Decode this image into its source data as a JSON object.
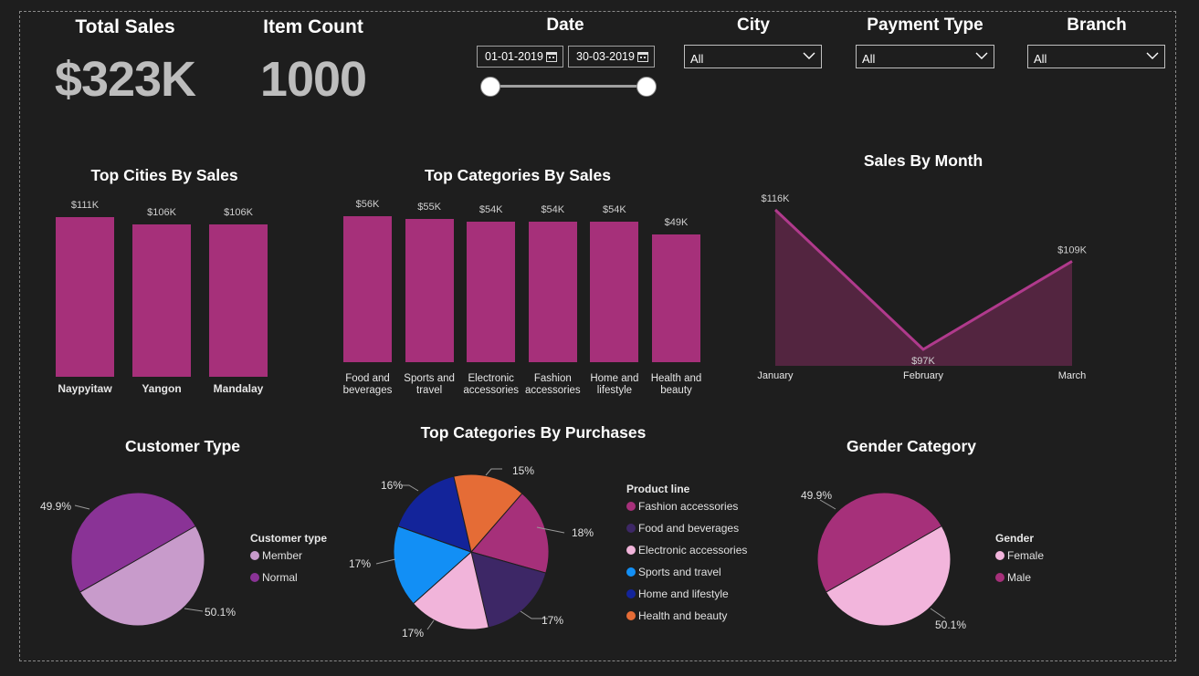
{
  "kpis": {
    "total_sales": {
      "title": "Total Sales",
      "value": "$323K"
    },
    "item_count": {
      "title": "Item Count",
      "value": "1000"
    }
  },
  "filters": {
    "date": {
      "title": "Date",
      "start": "01-01-2019",
      "end": "30-03-2019"
    },
    "city": {
      "title": "City",
      "value": "All"
    },
    "payment_type": {
      "title": "Payment Type",
      "value": "All"
    },
    "branch": {
      "title": "Branch",
      "value": "All"
    }
  },
  "colors": {
    "bar": "#a6307a",
    "line": "#b03a8c",
    "area": "#532540"
  },
  "charts": {
    "top_cities": {
      "title": "Top Cities By Sales",
      "chart_data": {
        "type": "bar",
        "categories": [
          "Naypyitaw",
          "Yangon",
          "Mandalay"
        ],
        "values": [
          111,
          106,
          106
        ],
        "labels": [
          "$111K",
          "$106K",
          "$106K"
        ],
        "unit": "K"
      }
    },
    "top_categories": {
      "title": "Top Categories By Sales",
      "chart_data": {
        "type": "bar",
        "categories": [
          [
            "Food and",
            "beverages"
          ],
          [
            "Sports and",
            "travel"
          ],
          [
            "Electronic",
            "accessories"
          ],
          [
            "Fashion",
            "accessories"
          ],
          [
            "Home and",
            "lifestyle"
          ],
          [
            "Health and",
            "beauty"
          ]
        ],
        "values": [
          56,
          55,
          54,
          54,
          54,
          49
        ],
        "labels": [
          "$56K",
          "$55K",
          "$54K",
          "$54K",
          "$54K",
          "$49K"
        ]
      }
    },
    "sales_by_month": {
      "title": "Sales By Month",
      "chart_data": {
        "type": "area",
        "categories": [
          "January",
          "February",
          "March"
        ],
        "values": [
          116,
          97,
          109
        ],
        "labels": [
          "$116K",
          "$97K",
          "$109K"
        ]
      }
    },
    "customer_type": {
      "title": "Customer Type",
      "legend_title": "Customer type",
      "chart_data": {
        "type": "pie",
        "series": [
          {
            "name": "Member",
            "value": 50.1,
            "label": "50.1%",
            "color": "#c89bcb"
          },
          {
            "name": "Normal",
            "value": 49.9,
            "label": "49.9%",
            "color": "#8a3396"
          }
        ]
      }
    },
    "top_categories_purchases": {
      "title": "Top Categories By Purchases",
      "legend_title": "Product line",
      "chart_data": {
        "type": "pie",
        "series": [
          {
            "name": "Fashion accessories",
            "value": 18,
            "label": "18%",
            "color": "#a6307a"
          },
          {
            "name": "Food and beverages",
            "value": 17,
            "label": "17%",
            "color": "#3d2766"
          },
          {
            "name": "Electronic accessories",
            "value": 17,
            "label": "17%",
            "color": "#f1b4da"
          },
          {
            "name": "Sports and travel",
            "value": 17,
            "label": "17%",
            "color": "#128ff5"
          },
          {
            "name": "Home and lifestyle",
            "value": 16,
            "label": "16%",
            "color": "#13249a"
          },
          {
            "name": "Health and beauty",
            "value": 15,
            "label": "15%",
            "color": "#e56c36"
          }
        ]
      }
    },
    "gender": {
      "title": "Gender Category",
      "legend_title": "Gender",
      "chart_data": {
        "type": "pie",
        "series": [
          {
            "name": "Female",
            "value": 50.1,
            "label": "50.1%",
            "color": "#f2b5dc"
          },
          {
            "name": "Male",
            "value": 49.9,
            "label": "49.9%",
            "color": "#a6307a"
          }
        ]
      }
    }
  }
}
